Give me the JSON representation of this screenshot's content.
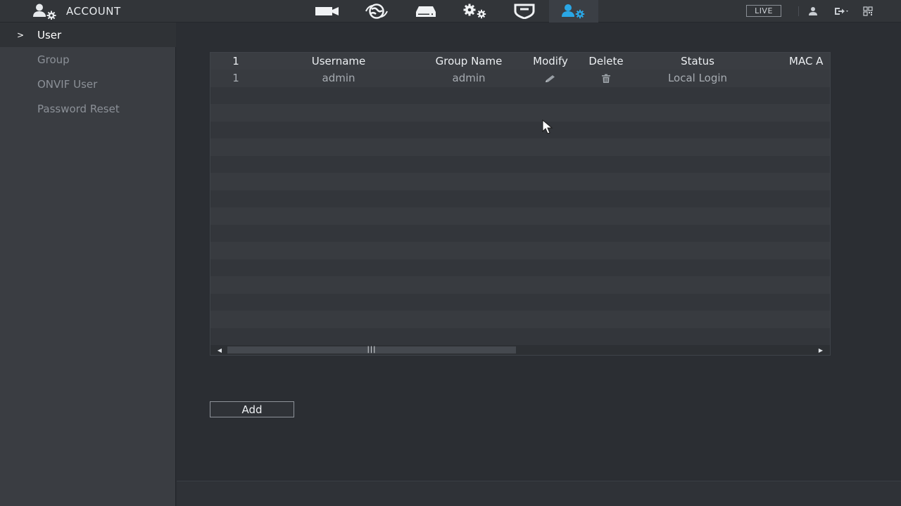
{
  "header": {
    "title": "ACCOUNT",
    "title_icon": "account-settings-icon",
    "nav": [
      {
        "icon": "camera-icon",
        "active": false
      },
      {
        "icon": "network-icon",
        "active": false
      },
      {
        "icon": "storage-icon",
        "active": false
      },
      {
        "icon": "system-settings-icon",
        "active": false
      },
      {
        "icon": "security-shield-icon",
        "active": false
      },
      {
        "icon": "account-icon",
        "active": true
      }
    ],
    "live_label": "LIVE",
    "tools": [
      "user-icon",
      "logout-icon",
      "qr-code-icon"
    ]
  },
  "sidebar": {
    "items": [
      {
        "label": "User",
        "active": true
      },
      {
        "label": "Group",
        "active": false
      },
      {
        "label": "ONVIF User",
        "active": false
      },
      {
        "label": "Password Reset",
        "active": false
      }
    ]
  },
  "table": {
    "columns": [
      "1",
      "Username",
      "Group Name",
      "Modify",
      "Delete",
      "Status",
      "MAC A"
    ],
    "rows": [
      {
        "index": "1",
        "username": "admin",
        "group": "admin",
        "modify_icon": "pencil-icon",
        "delete_icon": "trash-icon",
        "status": "Local Login"
      }
    ],
    "empty_rows": 15
  },
  "add_label": "Add",
  "colors": {
    "accent": "#2aa7e6",
    "background": "#2b2e33",
    "sidebar": "#3a3d42"
  }
}
